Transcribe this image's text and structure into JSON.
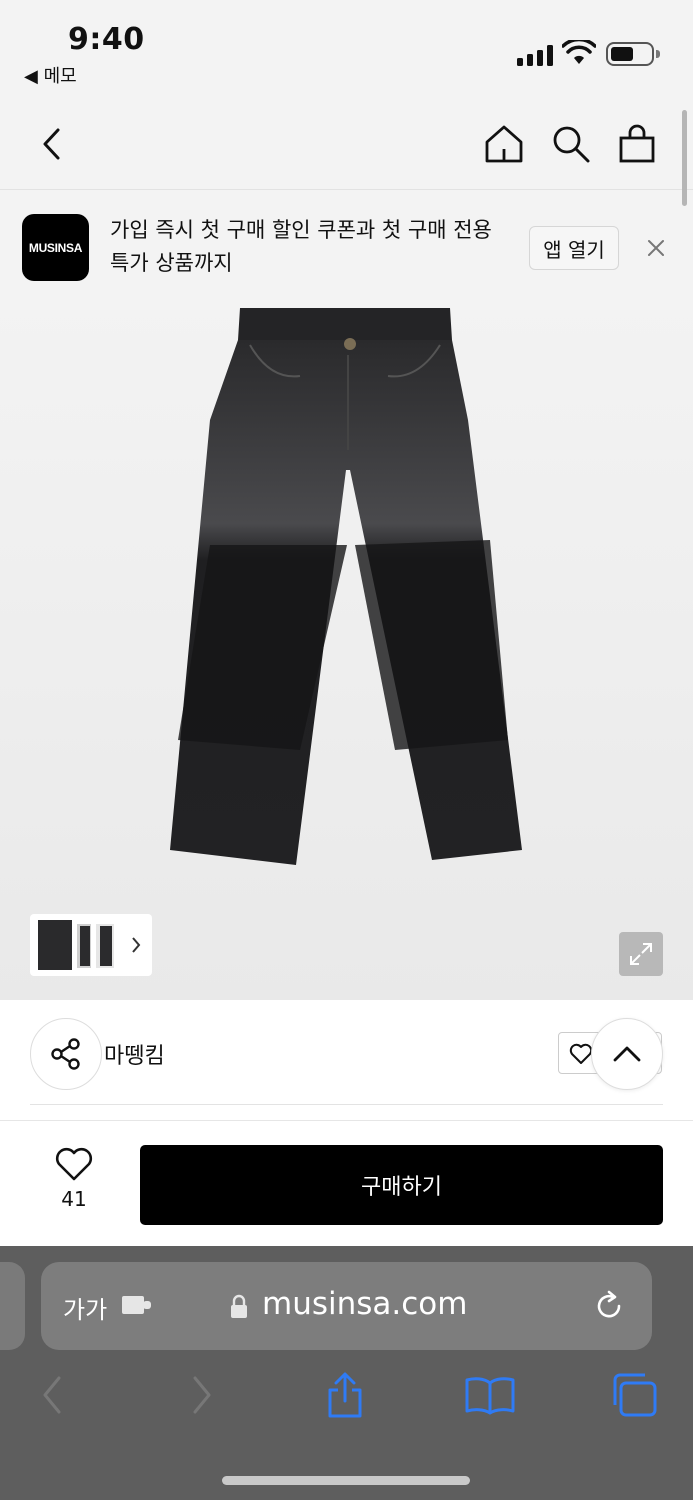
{
  "status_bar": {
    "time": "9:40",
    "back_app": "◀ 메모",
    "icons": [
      "signal-icon",
      "wifi-icon",
      "battery-icon"
    ]
  },
  "nav": {
    "icons": [
      "back-icon",
      "home-icon",
      "search-icon",
      "bag-icon"
    ]
  },
  "banner": {
    "logo_text": "MUSINSA",
    "text": "가입 즉시 첫 구매 할인 쿠폰과 첫 구매 전용 특가 상품까지",
    "open_app_label": "앱 열기",
    "close_icon": "close-icon"
  },
  "product": {
    "image_icon": "jeans-image",
    "brand": "마뗑킴"
  },
  "buy_bar": {
    "like_count": "41",
    "buy_label": "구매하기"
  },
  "safari": {
    "text_size_label": "가가",
    "url": "musinsa.com",
    "icons": [
      "extension-icon",
      "lock-icon",
      "reload-icon",
      "back-icon",
      "forward-icon",
      "share-icon",
      "bookmarks-icon",
      "tabs-icon"
    ]
  },
  "colors": {
    "background": "#f3f3f3",
    "buy_button": "#000000",
    "safari_bar": "#5e5e5e"
  }
}
